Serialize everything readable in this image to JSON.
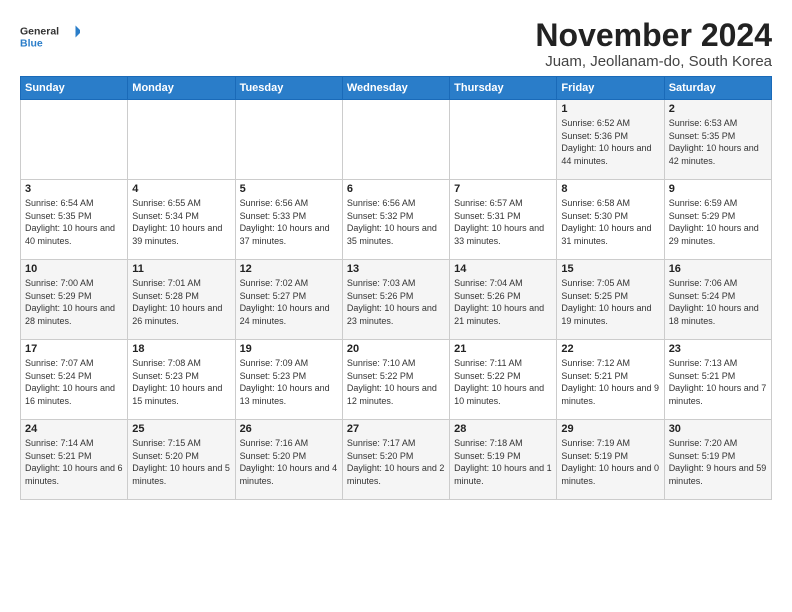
{
  "logo": {
    "line1": "General",
    "line2": "Blue"
  },
  "title": "November 2024",
  "location": "Juam, Jeollanam-do, South Korea",
  "headers": [
    "Sunday",
    "Monday",
    "Tuesday",
    "Wednesday",
    "Thursday",
    "Friday",
    "Saturday"
  ],
  "weeks": [
    [
      {
        "day": "",
        "text": ""
      },
      {
        "day": "",
        "text": ""
      },
      {
        "day": "",
        "text": ""
      },
      {
        "day": "",
        "text": ""
      },
      {
        "day": "",
        "text": ""
      },
      {
        "day": "1",
        "text": "Sunrise: 6:52 AM\nSunset: 5:36 PM\nDaylight: 10 hours and 44 minutes."
      },
      {
        "day": "2",
        "text": "Sunrise: 6:53 AM\nSunset: 5:35 PM\nDaylight: 10 hours and 42 minutes."
      }
    ],
    [
      {
        "day": "3",
        "text": "Sunrise: 6:54 AM\nSunset: 5:35 PM\nDaylight: 10 hours and 40 minutes."
      },
      {
        "day": "4",
        "text": "Sunrise: 6:55 AM\nSunset: 5:34 PM\nDaylight: 10 hours and 39 minutes."
      },
      {
        "day": "5",
        "text": "Sunrise: 6:56 AM\nSunset: 5:33 PM\nDaylight: 10 hours and 37 minutes."
      },
      {
        "day": "6",
        "text": "Sunrise: 6:56 AM\nSunset: 5:32 PM\nDaylight: 10 hours and 35 minutes."
      },
      {
        "day": "7",
        "text": "Sunrise: 6:57 AM\nSunset: 5:31 PM\nDaylight: 10 hours and 33 minutes."
      },
      {
        "day": "8",
        "text": "Sunrise: 6:58 AM\nSunset: 5:30 PM\nDaylight: 10 hours and 31 minutes."
      },
      {
        "day": "9",
        "text": "Sunrise: 6:59 AM\nSunset: 5:29 PM\nDaylight: 10 hours and 29 minutes."
      }
    ],
    [
      {
        "day": "10",
        "text": "Sunrise: 7:00 AM\nSunset: 5:29 PM\nDaylight: 10 hours and 28 minutes."
      },
      {
        "day": "11",
        "text": "Sunrise: 7:01 AM\nSunset: 5:28 PM\nDaylight: 10 hours and 26 minutes."
      },
      {
        "day": "12",
        "text": "Sunrise: 7:02 AM\nSunset: 5:27 PM\nDaylight: 10 hours and 24 minutes."
      },
      {
        "day": "13",
        "text": "Sunrise: 7:03 AM\nSunset: 5:26 PM\nDaylight: 10 hours and 23 minutes."
      },
      {
        "day": "14",
        "text": "Sunrise: 7:04 AM\nSunset: 5:26 PM\nDaylight: 10 hours and 21 minutes."
      },
      {
        "day": "15",
        "text": "Sunrise: 7:05 AM\nSunset: 5:25 PM\nDaylight: 10 hours and 19 minutes."
      },
      {
        "day": "16",
        "text": "Sunrise: 7:06 AM\nSunset: 5:24 PM\nDaylight: 10 hours and 18 minutes."
      }
    ],
    [
      {
        "day": "17",
        "text": "Sunrise: 7:07 AM\nSunset: 5:24 PM\nDaylight: 10 hours and 16 minutes."
      },
      {
        "day": "18",
        "text": "Sunrise: 7:08 AM\nSunset: 5:23 PM\nDaylight: 10 hours and 15 minutes."
      },
      {
        "day": "19",
        "text": "Sunrise: 7:09 AM\nSunset: 5:23 PM\nDaylight: 10 hours and 13 minutes."
      },
      {
        "day": "20",
        "text": "Sunrise: 7:10 AM\nSunset: 5:22 PM\nDaylight: 10 hours and 12 minutes."
      },
      {
        "day": "21",
        "text": "Sunrise: 7:11 AM\nSunset: 5:22 PM\nDaylight: 10 hours and 10 minutes."
      },
      {
        "day": "22",
        "text": "Sunrise: 7:12 AM\nSunset: 5:21 PM\nDaylight: 10 hours and 9 minutes."
      },
      {
        "day": "23",
        "text": "Sunrise: 7:13 AM\nSunset: 5:21 PM\nDaylight: 10 hours and 7 minutes."
      }
    ],
    [
      {
        "day": "24",
        "text": "Sunrise: 7:14 AM\nSunset: 5:21 PM\nDaylight: 10 hours and 6 minutes."
      },
      {
        "day": "25",
        "text": "Sunrise: 7:15 AM\nSunset: 5:20 PM\nDaylight: 10 hours and 5 minutes."
      },
      {
        "day": "26",
        "text": "Sunrise: 7:16 AM\nSunset: 5:20 PM\nDaylight: 10 hours and 4 minutes."
      },
      {
        "day": "27",
        "text": "Sunrise: 7:17 AM\nSunset: 5:20 PM\nDaylight: 10 hours and 2 minutes."
      },
      {
        "day": "28",
        "text": "Sunrise: 7:18 AM\nSunset: 5:19 PM\nDaylight: 10 hours and 1 minute."
      },
      {
        "day": "29",
        "text": "Sunrise: 7:19 AM\nSunset: 5:19 PM\nDaylight: 10 hours and 0 minutes."
      },
      {
        "day": "30",
        "text": "Sunrise: 7:20 AM\nSunset: 5:19 PM\nDaylight: 9 hours and 59 minutes."
      }
    ]
  ]
}
